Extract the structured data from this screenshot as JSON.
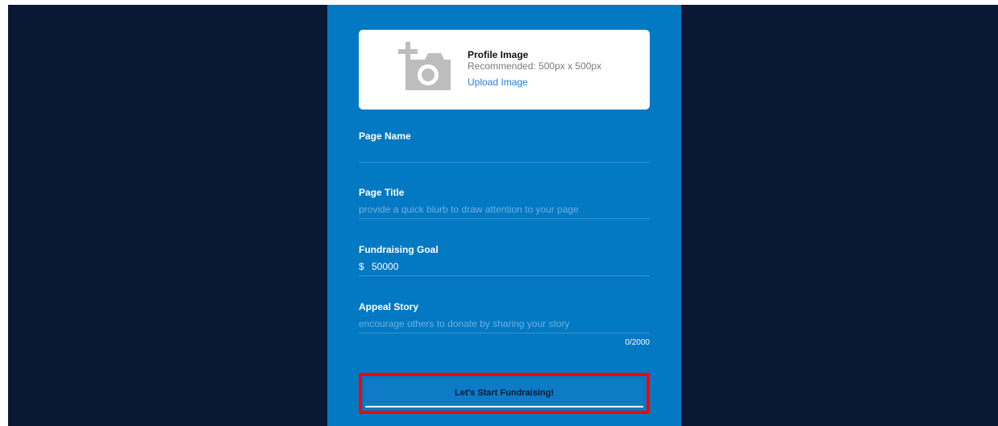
{
  "profile_image": {
    "title": "Profile Image",
    "hint": "Recommended: 500px x 500px",
    "upload_label": "Upload Image"
  },
  "fields": {
    "page_name": {
      "label": "Page Name",
      "value": "",
      "placeholder": ""
    },
    "page_title": {
      "label": "Page Title",
      "value": "",
      "placeholder": "provide a quick blurb to draw attention to your page"
    },
    "fundraising_goal": {
      "label": "Fundraising Goal",
      "currency": "$",
      "value": "50000"
    },
    "appeal_story": {
      "label": "Appeal Story",
      "value": "",
      "placeholder": "encourage others to donate by sharing your story",
      "char_count": "0/2000"
    }
  },
  "submit_label": "Let's Start Fundraising!",
  "colors": {
    "backdrop": "#0a1833",
    "panel": "#0378c3",
    "link": "#2a7ad8",
    "highlight": "#ff0000"
  }
}
